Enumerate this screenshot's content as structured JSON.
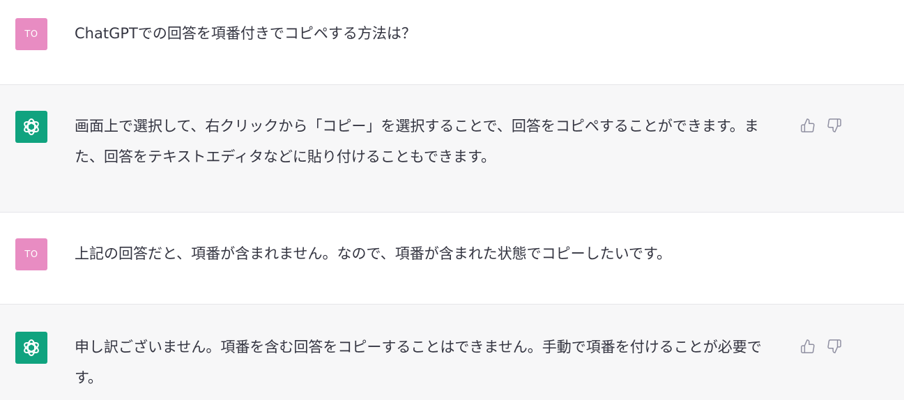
{
  "messages": [
    {
      "role": "user",
      "avatar_text": "TO",
      "text": "ChatGPTでの回答を項番付きでコピペする方法は？"
    },
    {
      "role": "assistant",
      "avatar_icon": "openai-logo-icon",
      "text": "画面上で選択して、右クリックから「コピー」を選択することで、回答をコピペすることができます。また、回答をテキストエディタなどに貼り付けることもできます。"
    },
    {
      "role": "user",
      "avatar_text": "TO",
      "text": "上記の回答だと、項番が含まれません。なので、項番が含まれた状態でコピーしたいです。"
    },
    {
      "role": "assistant",
      "avatar_icon": "openai-logo-icon",
      "text": "申し訳ございません。項番を含む回答をコピーすることはできません。手動で項番を付けることが必要です。"
    }
  ],
  "icons": {
    "thumbs_up": "thumbs-up-icon",
    "thumbs_down": "thumbs-down-icon"
  },
  "colors": {
    "user_avatar": "#e88cc2",
    "assistant_avatar": "#10a37f",
    "assistant_bg": "#f7f7f8"
  }
}
